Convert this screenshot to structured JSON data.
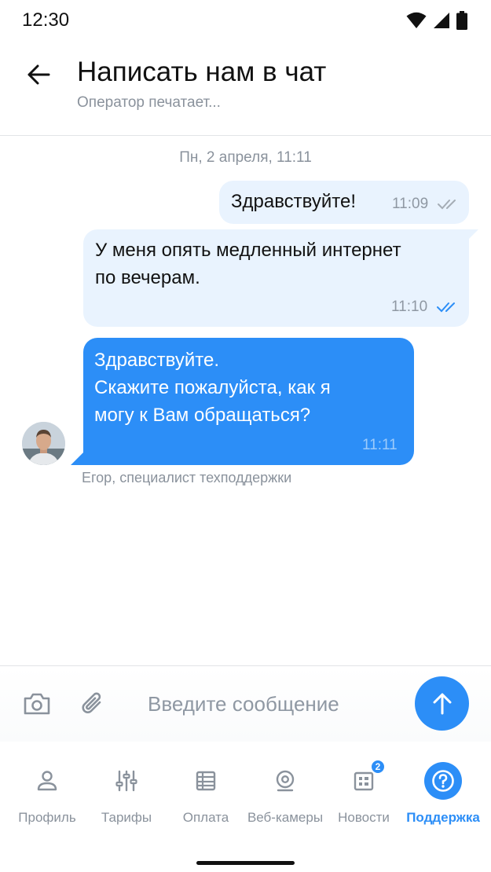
{
  "status_bar": {
    "time": "12:30",
    "icons": [
      "wifi-icon",
      "cellular-signal-icon",
      "battery-icon"
    ]
  },
  "header": {
    "title": "Написать нам в чат",
    "subtitle": "Оператор печатает..."
  },
  "chat": {
    "date_separator": "Пн, 2 апреля,  11:11",
    "messages": [
      {
        "direction": "outgoing",
        "text": "Здравствуйте!",
        "time": "11:09",
        "read": false
      },
      {
        "direction": "outgoing",
        "text": "У меня опять медленный интернет\nпо вечерам.",
        "time": "11:10",
        "read": true
      },
      {
        "direction": "incoming",
        "text": "Здравствуйте.\nСкажите пожалуйста, как я\nмогу к Вам обращаться?",
        "time": "11:11"
      }
    ],
    "sender_name": "Егор, специалист техподдержки"
  },
  "input": {
    "placeholder": "Введите сообщение",
    "value": ""
  },
  "bottom_nav": {
    "items": [
      {
        "label": "Профиль",
        "icon": "person-icon",
        "active": false
      },
      {
        "label": "Тарифы",
        "icon": "sliders-icon",
        "active": false
      },
      {
        "label": "Оплата",
        "icon": "payment-stack-icon",
        "active": false
      },
      {
        "label": "Веб-камеры",
        "icon": "webcam-icon",
        "active": false
      },
      {
        "label": "Новости",
        "icon": "news-icon",
        "active": false,
        "badge": "2"
      },
      {
        "label": "Поддержка",
        "icon": "help-circle-icon",
        "active": true
      }
    ]
  },
  "colors": {
    "accent": "#2c8ef7",
    "outgoing_bubble": "#e9f3fe",
    "muted_text": "#8a929c",
    "read_ticks": "#2c8ef7",
    "unread_ticks": "#a5adb6"
  }
}
